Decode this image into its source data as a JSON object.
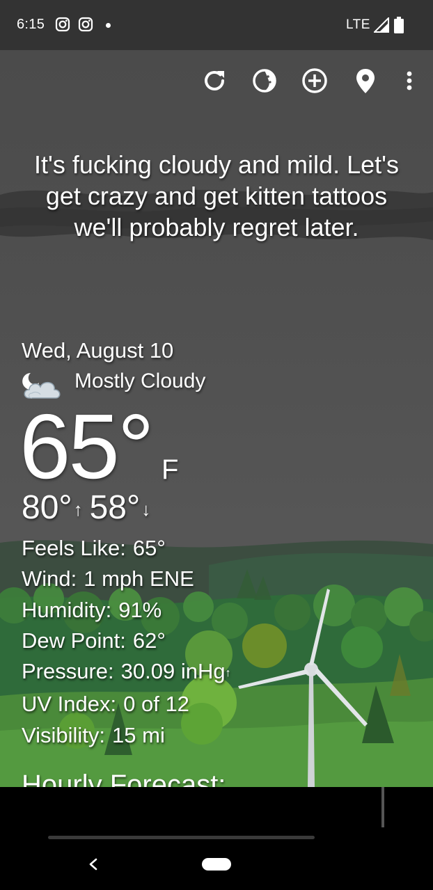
{
  "status_bar": {
    "time": "6:15",
    "network": "LTE",
    "icons": [
      "instagram-icon",
      "instagram-icon",
      "notification-dot",
      "signal-icon",
      "battery-icon"
    ]
  },
  "toolbar": {
    "icons": [
      "refresh-icon",
      "theme-icon",
      "add-location-icon",
      "location-pin-icon",
      "more-vert-icon"
    ]
  },
  "quote": "It's fucking cloudy and mild. Let's get crazy and get kitten tattoos we'll probably regret later.",
  "current": {
    "date": "Wed, August 10",
    "condition_icon": "partly-cloudy-night-icon",
    "condition": "Mostly Cloudy",
    "temperature": "65°",
    "unit": "F",
    "high": "80°",
    "high_arrow": "↑",
    "low": "58°",
    "low_arrow": "↓"
  },
  "details": {
    "feels_like_label": "Feels Like:",
    "feels_like_value": "65°",
    "wind_label": "Wind:",
    "wind_value": "1 mph ENE",
    "humidity_label": "Humidity:",
    "humidity_value": "91%",
    "dew_point_label": "Dew Point:",
    "dew_point_value": "62°",
    "pressure_label": "Pressure:",
    "pressure_value": "30.09 inHg",
    "pressure_trend": "↑",
    "uv_label": "UV Index:",
    "uv_value": "0 of 12",
    "visibility_label": "Visibility:",
    "visibility_value": "15 mi"
  },
  "hourly": {
    "title": "Hourly Forecast:"
  },
  "nav_bar": {
    "icons": [
      "back-icon",
      "home-pill"
    ]
  },
  "colors": {
    "status_bar": "#333333",
    "sky": "#4f4f4f",
    "hill_dark": "#3f5a45",
    "hill_green": "#4a8a3a",
    "text": "#ffffff"
  }
}
